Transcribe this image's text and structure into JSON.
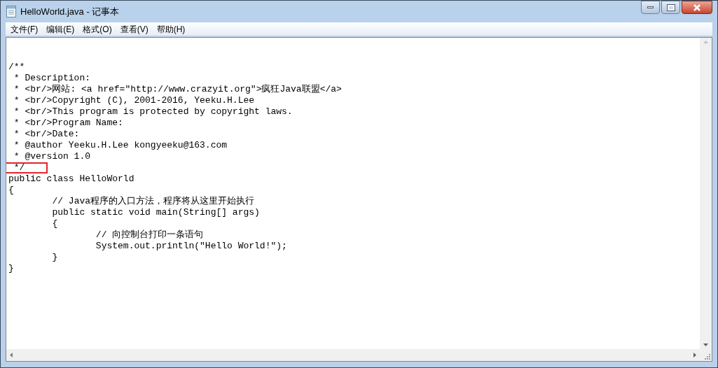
{
  "window": {
    "title": "HelloWorld.java - 记事本"
  },
  "menu": [
    {
      "label": "文件(F)"
    },
    {
      "label": "编辑(E)"
    },
    {
      "label": "格式(O)"
    },
    {
      "label": "查看(V)"
    },
    {
      "label": "帮助(H)"
    }
  ],
  "editor": {
    "lines": [
      {
        "text": "/**",
        "highlighted": false
      },
      {
        "text": " * Description:",
        "highlighted": false
      },
      {
        "text": " * <br/>网站: <a href=\"http://www.crazyit.org\">疯狂Java联盟</a>",
        "highlighted": false
      },
      {
        "text": " * <br/>Copyright (C), 2001-2016, Yeeku.H.Lee",
        "highlighted": false
      },
      {
        "text": " * <br/>This program is protected by copyright laws.",
        "highlighted": false
      },
      {
        "text": " * <br/>Program Name:",
        "highlighted": false
      },
      {
        "text": " * <br/>Date:",
        "highlighted": false
      },
      {
        "text": " * @author Yeeku.H.Lee kongyeeku@163.com",
        "highlighted": false
      },
      {
        "text": " * @version 1.0",
        "highlighted": false
      },
      {
        "text": " */",
        "highlighted": true
      },
      {
        "text": "public class HelloWorld",
        "highlighted": false
      },
      {
        "text": "{",
        "highlighted": false
      },
      {
        "text": "\t// Java程序的入口方法，程序将从这里开始执行",
        "highlighted": false
      },
      {
        "text": "\tpublic static void main(String[] args)",
        "highlighted": false
      },
      {
        "text": "\t{",
        "highlighted": false
      },
      {
        "text": "\t\t// 向控制台打印一条语句",
        "highlighted": false
      },
      {
        "text": "\t\tSystem.out.println(\"Hello World!\");",
        "highlighted": false
      },
      {
        "text": "\t}",
        "highlighted": false
      },
      {
        "text": "}",
        "highlighted": false
      }
    ]
  }
}
